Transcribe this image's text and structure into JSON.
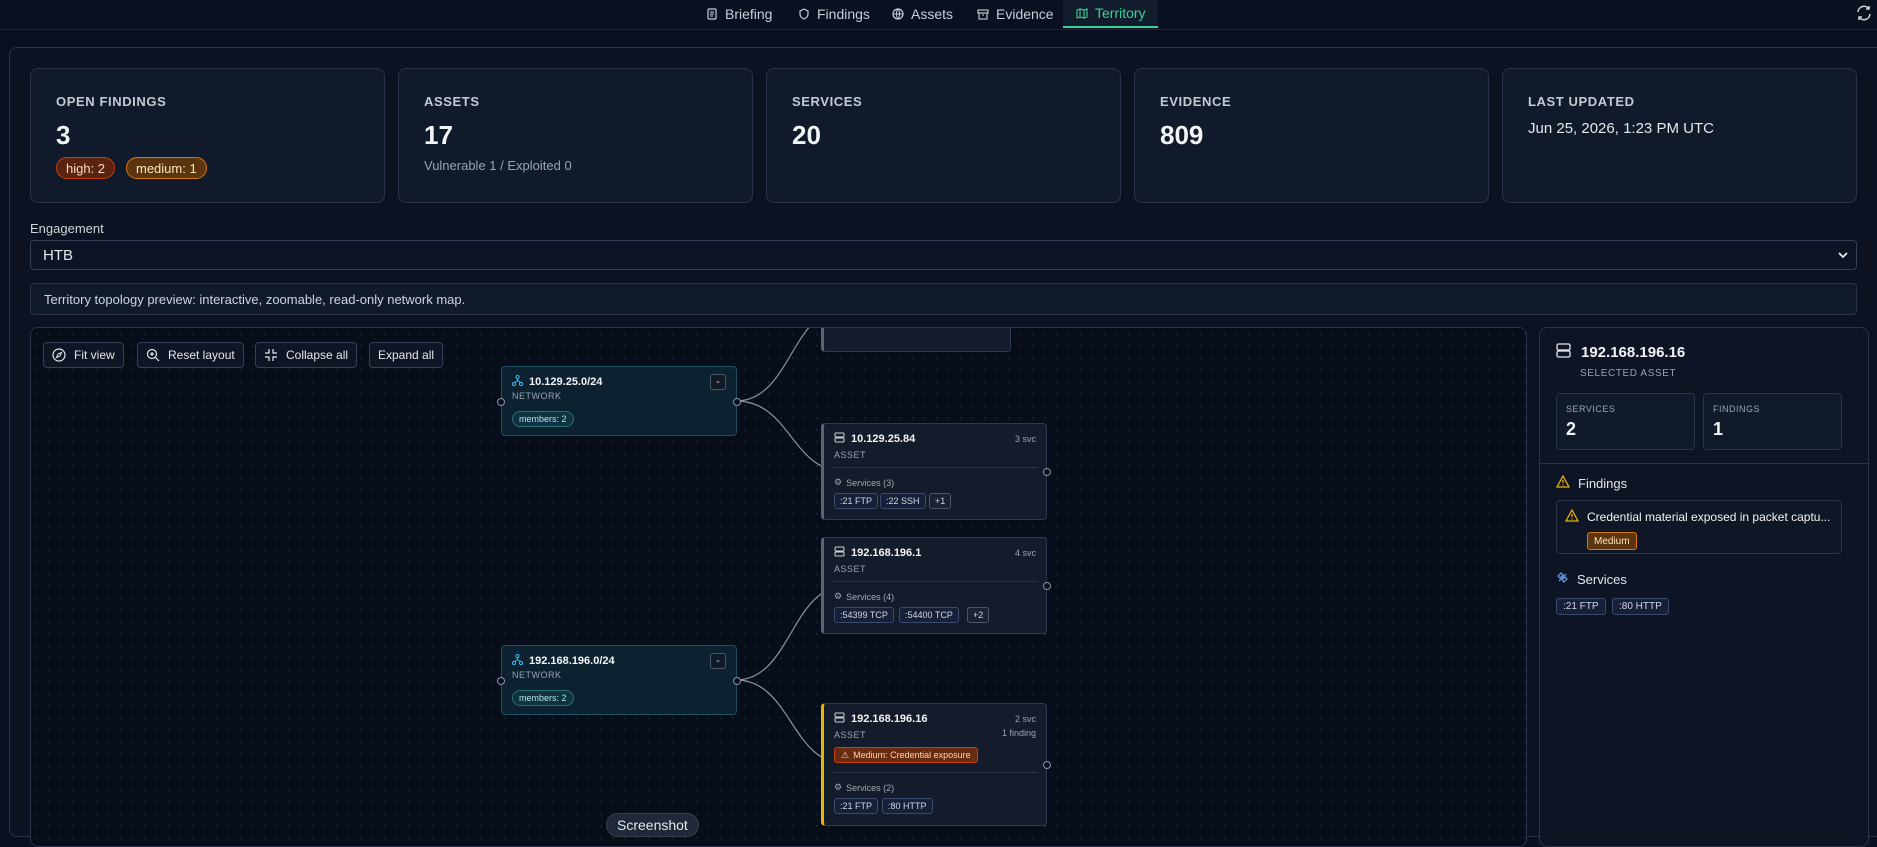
{
  "nav": {
    "tabs": [
      {
        "label": "Briefing",
        "icon": "briefing-icon"
      },
      {
        "label": "Findings",
        "icon": "findings-icon"
      },
      {
        "label": "Assets",
        "icon": "globe-icon"
      },
      {
        "label": "Evidence",
        "icon": "archive-icon"
      },
      {
        "label": "Territory",
        "icon": "map-icon",
        "active": true
      }
    ]
  },
  "stats": {
    "open_findings": {
      "label": "OPEN FINDINGS",
      "value": "3",
      "high": "high: 2",
      "medium": "medium: 1"
    },
    "assets": {
      "label": "ASSETS",
      "value": "17",
      "sub": "Vulnerable 1 / Exploited 0"
    },
    "services": {
      "label": "SERVICES",
      "value": "20"
    },
    "evidence": {
      "label": "EVIDENCE",
      "value": "809"
    },
    "last_updated": {
      "label": "LAST UPDATED",
      "value": "Jun 25, 2026, 1:23 PM UTC"
    }
  },
  "engagement": {
    "label": "Engagement",
    "selected": "HTB"
  },
  "preview_text": "Territory topology preview: interactive, zoomable, read-only network map.",
  "toolbar": {
    "fit": "Fit view",
    "reset": "Reset layout",
    "collapse": "Collapse all",
    "expand": "Expand all"
  },
  "graph": {
    "networks": [
      {
        "label": "10.129.25.0/24",
        "kind": "NETWORK",
        "members": "members: 2",
        "toggle": "-"
      },
      {
        "label": "192.168.196.0/24",
        "kind": "NETWORK",
        "members": "members: 2",
        "toggle": "-"
      }
    ],
    "assets": [
      {
        "label": "10.129.25.84",
        "kind": "ASSET",
        "svc": "3 svc",
        "services_head": "Services (3)",
        "chips": [
          ":21 FTP",
          ":22 SSH",
          "+1"
        ]
      },
      {
        "label": "192.168.196.1",
        "kind": "ASSET",
        "svc": "4 svc",
        "services_head": "Services (4)",
        "chips": [
          ":54399 TCP",
          ":54400 TCP",
          "+2"
        ]
      },
      {
        "label": "192.168.196.16",
        "kind": "ASSET",
        "svc": "2 svc",
        "findings": "1 finding",
        "warning": "Medium: Credential exposure",
        "services_head": "Services (2)",
        "chips": [
          ":21 FTP",
          ":80 HTTP"
        ]
      }
    ]
  },
  "detail": {
    "title": "192.168.196.16",
    "subtitle": "SELECTED ASSET",
    "services_label": "SERVICES",
    "services_value": "2",
    "findings_label": "FINDINGS",
    "findings_value": "1",
    "findings_heading": "Findings",
    "finding_title": "Credential material exposed in packet captu...",
    "finding_severity": "Medium",
    "services_heading": "Services",
    "service_chips": [
      ":21 FTP",
      ":80 HTTP"
    ]
  },
  "tooltip": "Screenshot",
  "colors": {
    "accent": "#34d399",
    "warning": "#eab308",
    "high": "#c2410c",
    "medium": "#d97706"
  }
}
